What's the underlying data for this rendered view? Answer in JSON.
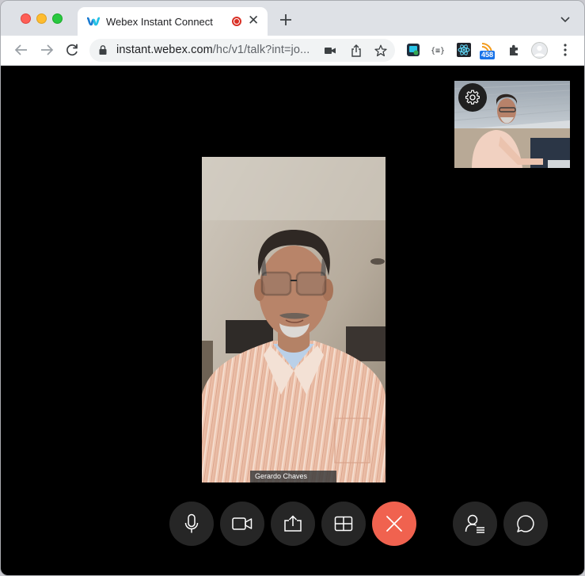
{
  "browser": {
    "tab": {
      "title": "Webex Instant Connect"
    },
    "url": {
      "host": "instant.webex.com",
      "path": "/hc/v1/talk?int=jo..."
    },
    "extensions": {
      "badge_count": "458"
    }
  },
  "call": {
    "remote_participant_name": "Gerardo Chaves"
  },
  "colors": {
    "end_call": "#f0624f",
    "control_bg": "#262626",
    "content_bg": "#000000"
  }
}
